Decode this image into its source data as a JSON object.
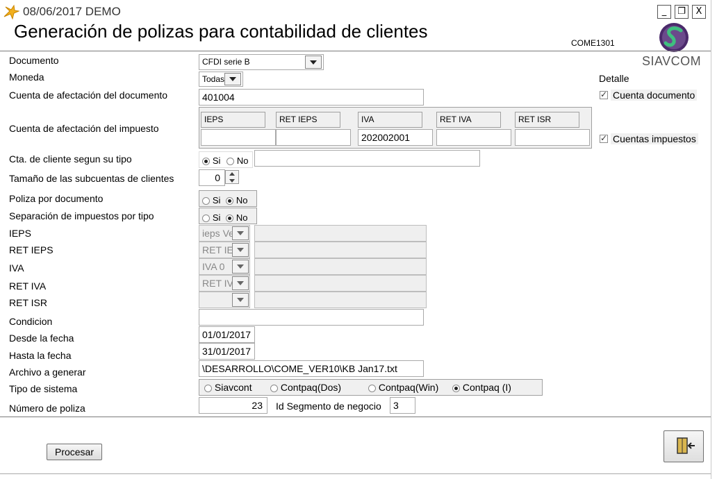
{
  "window": {
    "title": "08/06/2017  DEMO",
    "minimize": "_",
    "restore": "❐",
    "close": "X"
  },
  "header": {
    "title": "Generación de polizas para contabilidad de clientes",
    "code": "COME1301",
    "logo_text": "SIAVCOM"
  },
  "labels": {
    "documento": "Documento",
    "moneda": "Moneda",
    "cuenta_documento": "Cuenta de afectación del documento",
    "cuenta_impuesto": "Cuenta de afectación del impuesto",
    "cta_cliente_tipo": "Cta. de cliente segun su tipo",
    "tamano_subcuentas": "Tamaño de las subcuentas de clientes",
    "poliza_documento": "Poliza por documento",
    "separacion_impuestos": "Separación de impuestos por tipo",
    "ieps": "IEPS",
    "ret_ieps": "RET IEPS",
    "iva": "IVA",
    "ret_iva": "RET IVA",
    "ret_isr": "RET ISR",
    "condicion": "Condicion",
    "desde_fecha": "Desde la fecha",
    "hasta_fecha": "Hasta la fecha",
    "archivo": "Archivo a generar",
    "tipo_sistema": "Tipo de sistema",
    "numero_poliza": "Número de poliza",
    "id_segmento": "Id Segmento de negocio"
  },
  "values": {
    "documento": "CFDI serie B",
    "moneda": "Todas",
    "cuenta_documento": "401004",
    "cta_cliente_text": "",
    "tamano_subcuentas": "0",
    "condicion": "",
    "desde_fecha": "01/01/2017",
    "hasta_fecha": "31/01/2017",
    "archivo": "\\DESARROLLO\\COME_VER10\\KB Jan17.txt",
    "numero_poliza": "23",
    "id_segmento": "3"
  },
  "tax_accounts": {
    "headers": [
      "IEPS",
      "RET IEPS",
      "IVA",
      "RET IVA",
      "RET ISR"
    ],
    "values": [
      "",
      "",
      "202002001",
      "",
      ""
    ]
  },
  "tax_selects": {
    "ieps": "ieps Ve",
    "ret_ieps": "RET IE",
    "iva": "IVA 0",
    "ret_iva": "RET IV",
    "ret_isr": ""
  },
  "radios": {
    "si": "Si",
    "no": "No",
    "cta_cliente_selected": "Si",
    "poliza_documento_selected": "No",
    "separacion_selected": "No"
  },
  "sistemas": {
    "options": [
      "Siavcont",
      "Contpaq(Dos)",
      "Contpaq(Win)",
      "Contpaq (I)"
    ],
    "selected": "Contpaq (I)"
  },
  "detalle": {
    "title": "Detalle",
    "cuenta_documento": "Cuenta documento",
    "cuentas_impuestos": "Cuentas impuestos"
  },
  "buttons": {
    "procesar": "Procesar"
  },
  "colors": {
    "logo_green": "#2e8b57",
    "logo_purple": "#4b2a6b"
  }
}
